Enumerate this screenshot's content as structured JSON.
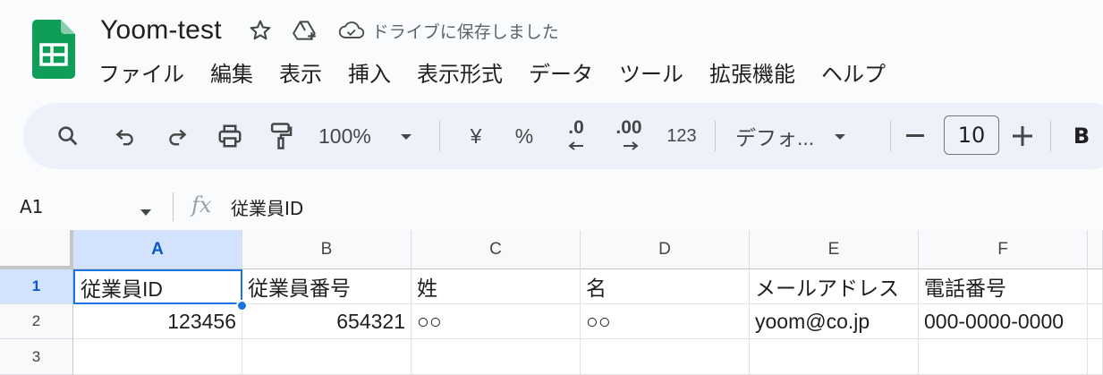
{
  "header": {
    "doc_title": "Yoom-test",
    "saved_status": "ドライブに保存しました"
  },
  "menu": [
    "ファイル",
    "編集",
    "表示",
    "挿入",
    "表示形式",
    "データ",
    "ツール",
    "拡張機能",
    "ヘルプ"
  ],
  "toolbar": {
    "zoom": "100%",
    "currency": "¥",
    "percent": "%",
    "decimal_decrease": ".0",
    "decimal_increase": ".00",
    "number_format": "123",
    "font": "デフォ...",
    "font_size": "10",
    "bold": "B"
  },
  "formula_bar": {
    "cell_ref": "A1",
    "fx": "fx",
    "content": "従業員ID"
  },
  "sheet": {
    "columns": [
      "A",
      "B",
      "C",
      "D",
      "E",
      "F"
    ],
    "rows": [
      "1",
      "2",
      "3"
    ],
    "cells": [
      [
        "従業員ID",
        "従業員番号",
        "姓",
        "名",
        "メールアドレス",
        "電話番号"
      ],
      [
        "123456",
        "654321",
        "○○",
        "○○",
        "yoom@co.jp",
        "000-0000-0000"
      ],
      [
        "",
        "",
        "",
        "",
        "",
        ""
      ]
    ]
  },
  "colors": {
    "accent": "#1a73e8",
    "selected_header_bg": "#d3e3fd",
    "toolbar_bg": "#edf2fa",
    "sheets_green": "#0f9d58"
  }
}
